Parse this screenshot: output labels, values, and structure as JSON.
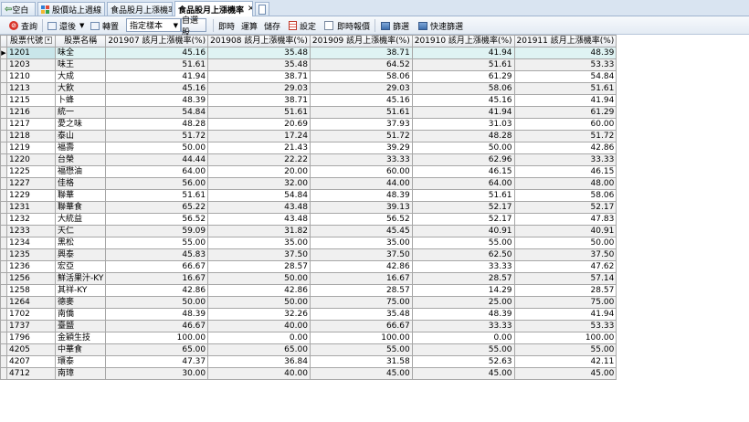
{
  "tabs": [
    {
      "label": "空白",
      "active": false
    },
    {
      "label": "股價站上週線",
      "active": false
    },
    {
      "label": "食品股月上漲機率",
      "active": false
    },
    {
      "label": "食品股月上漲機率",
      "active": true
    }
  ],
  "toolbar": {
    "query_label": "查詢",
    "adjust_label": "還後",
    "transpose_label": "轉置",
    "sample_select": "指定樣本",
    "self_select_label": "自選股",
    "realtime_label": "即時",
    "compute_label": "運算",
    "save_label": "儲存",
    "settings_label": "設定",
    "realtime_report_label": "即時報價",
    "filter_label": "篩選",
    "quick_filter_label": "快速篩選"
  },
  "table": {
    "columns": [
      "股票代號",
      "股票名稱",
      "201907 該月上漲機率(%)",
      "201908 該月上漲機率(%)",
      "201909 該月上漲機率(%)",
      "201910 該月上漲機率(%)",
      "201911 該月上漲機率(%)"
    ],
    "rows": [
      [
        "1201",
        "味全",
        "45.16",
        "35.48",
        "38.71",
        "41.94",
        "48.39"
      ],
      [
        "1203",
        "味王",
        "51.61",
        "35.48",
        "64.52",
        "51.61",
        "53.33"
      ],
      [
        "1210",
        "大成",
        "41.94",
        "38.71",
        "58.06",
        "61.29",
        "54.84"
      ],
      [
        "1213",
        "大飲",
        "45.16",
        "29.03",
        "29.03",
        "58.06",
        "51.61"
      ],
      [
        "1215",
        "卜蜂",
        "48.39",
        "38.71",
        "45.16",
        "45.16",
        "41.94"
      ],
      [
        "1216",
        "統一",
        "54.84",
        "51.61",
        "51.61",
        "41.94",
        "61.29"
      ],
      [
        "1217",
        "愛之味",
        "48.28",
        "20.69",
        "37.93",
        "31.03",
        "60.00"
      ],
      [
        "1218",
        "泰山",
        "51.72",
        "17.24",
        "51.72",
        "48.28",
        "51.72"
      ],
      [
        "1219",
        "福壽",
        "50.00",
        "21.43",
        "39.29",
        "50.00",
        "42.86"
      ],
      [
        "1220",
        "台榮",
        "44.44",
        "22.22",
        "33.33",
        "62.96",
        "33.33"
      ],
      [
        "1225",
        "福懋油",
        "64.00",
        "20.00",
        "60.00",
        "46.15",
        "46.15"
      ],
      [
        "1227",
        "佳格",
        "56.00",
        "32.00",
        "44.00",
        "64.00",
        "48.00"
      ],
      [
        "1229",
        "聯華",
        "51.61",
        "54.84",
        "48.39",
        "51.61",
        "58.06"
      ],
      [
        "1231",
        "聯華食",
        "65.22",
        "43.48",
        "39.13",
        "52.17",
        "52.17"
      ],
      [
        "1232",
        "大統益",
        "56.52",
        "43.48",
        "56.52",
        "52.17",
        "47.83"
      ],
      [
        "1233",
        "天仁",
        "59.09",
        "31.82",
        "45.45",
        "40.91",
        "40.91"
      ],
      [
        "1234",
        "黑松",
        "55.00",
        "35.00",
        "35.00",
        "55.00",
        "50.00"
      ],
      [
        "1235",
        "興泰",
        "45.83",
        "37.50",
        "37.50",
        "62.50",
        "37.50"
      ],
      [
        "1236",
        "宏亞",
        "66.67",
        "28.57",
        "42.86",
        "33.33",
        "47.62"
      ],
      [
        "1256",
        "鮮活果汁-KY",
        "16.67",
        "50.00",
        "16.67",
        "28.57",
        "57.14"
      ],
      [
        "1258",
        "其祥-KY",
        "42.86",
        "42.86",
        "28.57",
        "14.29",
        "28.57"
      ],
      [
        "1264",
        "德麥",
        "50.00",
        "50.00",
        "75.00",
        "25.00",
        "75.00"
      ],
      [
        "1702",
        "南僑",
        "48.39",
        "32.26",
        "35.48",
        "48.39",
        "41.94"
      ],
      [
        "1737",
        "臺鹽",
        "46.67",
        "40.00",
        "66.67",
        "33.33",
        "53.33"
      ],
      [
        "1796",
        "金穎生技",
        "100.00",
        "0.00",
        "100.00",
        "0.00",
        "100.00"
      ],
      [
        "4205",
        "中華食",
        "65.00",
        "65.00",
        "55.00",
        "55.00",
        "55.00"
      ],
      [
        "4207",
        "環泰",
        "47.37",
        "36.84",
        "31.58",
        "52.63",
        "42.11"
      ],
      [
        "4712",
        "南璋",
        "30.00",
        "40.00",
        "45.00",
        "45.00",
        "45.00"
      ]
    ],
    "selected_row": 0
  }
}
